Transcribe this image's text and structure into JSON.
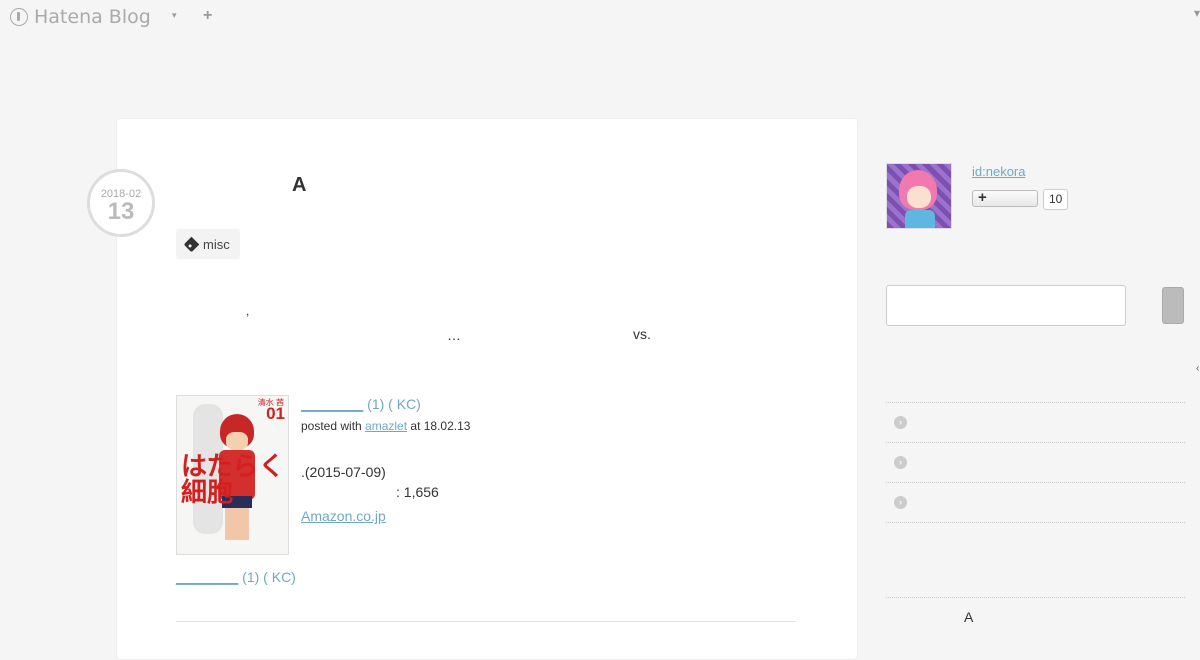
{
  "header": {
    "logo_text": "Hatena Blog",
    "caret": "▾",
    "plus": "+",
    "right_glyph": "▾"
  },
  "entry": {
    "date_ym": "2018-02",
    "date_day": "13",
    "title": "A",
    "tag": "misc",
    "body_fragments": [
      ",",
      "…",
      "vs."
    ]
  },
  "book": {
    "title_underline": "________",
    "title_rest": " (1) (            KC)",
    "posted_prefix": "posted with ",
    "posted_link": "amazlet",
    "posted_suffix": " at 18.02.13",
    "release": ".(2015-07-09)",
    "price": ": 1,656",
    "amazon": "Amazon.co.jp",
    "cover_kanji": "はたらく細胞",
    "cover_volume": "01",
    "cover_author": "清水 茜",
    "link2_underline": "________",
    "link2_rest": " (1) (            KC)"
  },
  "sidebar": {
    "user_id": "id:nekora",
    "subscribe_plus": "+",
    "subscribe_count": "10",
    "search_placeholder": "",
    "right_mark": "‹",
    "category_items": [
      "",
      "",
      ""
    ],
    "chevron": "›",
    "module_title": "A"
  }
}
